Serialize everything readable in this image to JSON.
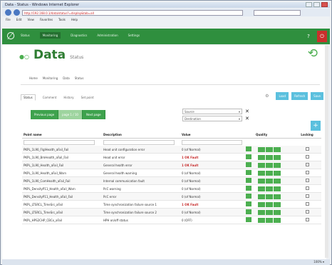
{
  "browser": {
    "title": "Data - Status - Windows Internet Explorer",
    "address": "http://192.168.0.1/data/status?=display&tab=all",
    "menu": [
      "File",
      "Edit",
      "View",
      "Favorites",
      "Tools",
      "Help"
    ],
    "zoom": "100% ▾"
  },
  "nav": {
    "items": [
      "Status",
      "Monitoring",
      "Diagnostics",
      "Administration",
      "Settings"
    ],
    "active_index": 1
  },
  "page": {
    "title": "Data",
    "subtitle": "Status"
  },
  "breadcrumb": [
    "Home",
    "Monitoring",
    "Data",
    "Status"
  ],
  "subtabs": [
    "Status",
    "Comment",
    "History",
    "Set point"
  ],
  "right_buttons": [
    "Load",
    "Refresh",
    "Save"
  ],
  "green_buttons": [
    "Previous page",
    "page 1 / 10",
    "Next page"
  ],
  "filters": [
    "Source",
    "Destination"
  ],
  "table": {
    "columns": [
      "Point name",
      "Description",
      "Value",
      "",
      "Quality",
      "Locking"
    ],
    "rows": [
      {
        "name": "PKPL_1L90_FlglHealth_aFail_Fail",
        "desc": "Head unit configuration error",
        "value": "0 (of Normal)",
        "red": false
      },
      {
        "name": "PKPL_1L90_BmHealth_aFail_Fail",
        "desc": "Head unit error",
        "value": "1 OK Fault",
        "red": true
      },
      {
        "name": "PKPL_1L90_Health_aFail_Fail",
        "desc": "General health error",
        "value": "1 OK Fault",
        "red": true
      },
      {
        "name": "PKPL_1L90_Health_aFail_Warn",
        "desc": "General health warning",
        "value": "0 (of Normal)",
        "red": false
      },
      {
        "name": "PKPL_1L90_ComHealth_aFail_Fail",
        "desc": "Internal communication fault",
        "value": "0 (of Normal)",
        "red": false
      },
      {
        "name": "PKPL_DensityP11_Health_aFail_Warn",
        "desc": "PcC warning",
        "value": "0 (of Normal)",
        "red": false
      },
      {
        "name": "PKPL_DensityP11_Health_aFail_Fail",
        "desc": "PcC error",
        "value": "0 (of Normal)",
        "red": false
      },
      {
        "name": "PKPL_LTSRCL_TimeSrc_aFail",
        "desc": "Time synchronization failure source 1",
        "value": "1 OK Fault",
        "red": true
      },
      {
        "name": "PKPL_LTSRCL_TimeSrc_aFail",
        "desc": "Time synchronization failure source 2",
        "value": "0 (of Normal)",
        "red": false
      },
      {
        "name": "PKPL_HPS2CHP_CBCx_aFail",
        "desc": "HPH on/off status",
        "value": "0 (OFF)",
        "red": false
      }
    ]
  },
  "status_text": "100%  ▾"
}
